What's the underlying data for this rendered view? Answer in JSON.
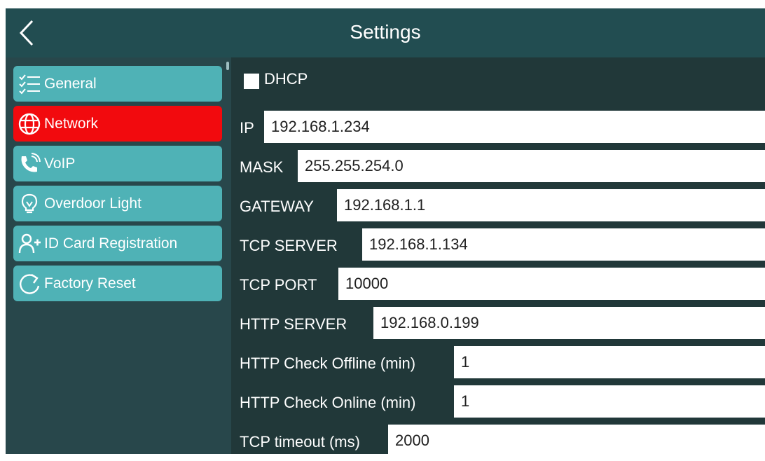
{
  "header": {
    "title": "Settings"
  },
  "sidebar": {
    "items": [
      {
        "label": "General",
        "icon": "checklist-icon",
        "active": false
      },
      {
        "label": "Network",
        "icon": "globe-icon",
        "active": true
      },
      {
        "label": "VoIP",
        "icon": "phone-icon",
        "active": false
      },
      {
        "label": "Overdoor Light",
        "icon": "lightbulb-icon",
        "active": false
      },
      {
        "label": "ID Card Registration",
        "icon": "add-user-icon",
        "active": false
      },
      {
        "label": "Factory Reset",
        "icon": "reset-icon",
        "active": false
      }
    ]
  },
  "network": {
    "dhcp": {
      "label": "DHCP",
      "checked": false
    },
    "fields": [
      {
        "label": "IP",
        "value": "192.168.1.234"
      },
      {
        "label": "MASK",
        "value": "255.255.254.0"
      },
      {
        "label": "GATEWAY",
        "value": "192.168.1.1"
      },
      {
        "label": "TCP SERVER",
        "value": "192.168.1.134"
      },
      {
        "label": "TCP PORT",
        "value": "10000"
      },
      {
        "label": "HTTP SERVER",
        "value": "192.168.0.199"
      },
      {
        "label": "HTTP Check Offline (min)",
        "value": "1"
      },
      {
        "label": "HTTP Check Online (min)",
        "value": "1"
      },
      {
        "label": "TCP timeout (ms)",
        "value": "2000"
      }
    ]
  },
  "colors": {
    "header_bg": "#224d51",
    "sidebar_item": "#4fb2b6",
    "sidebar_active": "#f20a0e",
    "content_bg": "#213839"
  }
}
